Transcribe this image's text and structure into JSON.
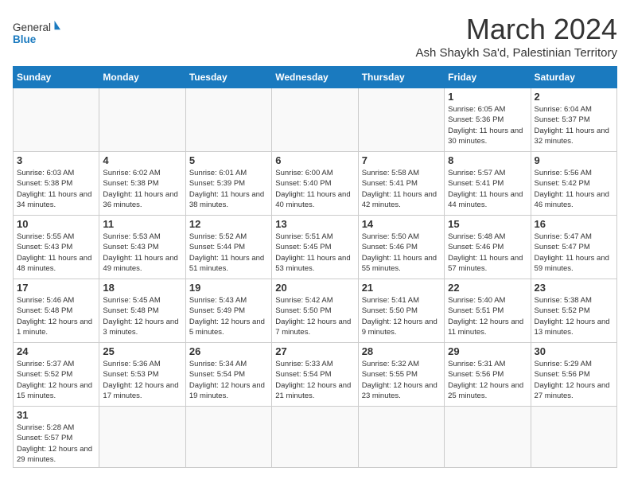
{
  "header": {
    "logo_general": "General",
    "logo_blue": "Blue",
    "month_title": "March 2024",
    "subtitle": "Ash Shaykh Sa'd, Palestinian Territory"
  },
  "weekdays": [
    "Sunday",
    "Monday",
    "Tuesday",
    "Wednesday",
    "Thursday",
    "Friday",
    "Saturday"
  ],
  "weeks": [
    [
      {
        "day": "",
        "info": ""
      },
      {
        "day": "",
        "info": ""
      },
      {
        "day": "",
        "info": ""
      },
      {
        "day": "",
        "info": ""
      },
      {
        "day": "",
        "info": ""
      },
      {
        "day": "1",
        "info": "Sunrise: 6:05 AM\nSunset: 5:36 PM\nDaylight: 11 hours\nand 30 minutes."
      },
      {
        "day": "2",
        "info": "Sunrise: 6:04 AM\nSunset: 5:37 PM\nDaylight: 11 hours\nand 32 minutes."
      }
    ],
    [
      {
        "day": "3",
        "info": "Sunrise: 6:03 AM\nSunset: 5:38 PM\nDaylight: 11 hours\nand 34 minutes."
      },
      {
        "day": "4",
        "info": "Sunrise: 6:02 AM\nSunset: 5:38 PM\nDaylight: 11 hours\nand 36 minutes."
      },
      {
        "day": "5",
        "info": "Sunrise: 6:01 AM\nSunset: 5:39 PM\nDaylight: 11 hours\nand 38 minutes."
      },
      {
        "day": "6",
        "info": "Sunrise: 6:00 AM\nSunset: 5:40 PM\nDaylight: 11 hours\nand 40 minutes."
      },
      {
        "day": "7",
        "info": "Sunrise: 5:58 AM\nSunset: 5:41 PM\nDaylight: 11 hours\nand 42 minutes."
      },
      {
        "day": "8",
        "info": "Sunrise: 5:57 AM\nSunset: 5:41 PM\nDaylight: 11 hours\nand 44 minutes."
      },
      {
        "day": "9",
        "info": "Sunrise: 5:56 AM\nSunset: 5:42 PM\nDaylight: 11 hours\nand 46 minutes."
      }
    ],
    [
      {
        "day": "10",
        "info": "Sunrise: 5:55 AM\nSunset: 5:43 PM\nDaylight: 11 hours\nand 48 minutes."
      },
      {
        "day": "11",
        "info": "Sunrise: 5:53 AM\nSunset: 5:43 PM\nDaylight: 11 hours\nand 49 minutes."
      },
      {
        "day": "12",
        "info": "Sunrise: 5:52 AM\nSunset: 5:44 PM\nDaylight: 11 hours\nand 51 minutes."
      },
      {
        "day": "13",
        "info": "Sunrise: 5:51 AM\nSunset: 5:45 PM\nDaylight: 11 hours\nand 53 minutes."
      },
      {
        "day": "14",
        "info": "Sunrise: 5:50 AM\nSunset: 5:46 PM\nDaylight: 11 hours\nand 55 minutes."
      },
      {
        "day": "15",
        "info": "Sunrise: 5:48 AM\nSunset: 5:46 PM\nDaylight: 11 hours\nand 57 minutes."
      },
      {
        "day": "16",
        "info": "Sunrise: 5:47 AM\nSunset: 5:47 PM\nDaylight: 11 hours\nand 59 minutes."
      }
    ],
    [
      {
        "day": "17",
        "info": "Sunrise: 5:46 AM\nSunset: 5:48 PM\nDaylight: 12 hours\nand 1 minute."
      },
      {
        "day": "18",
        "info": "Sunrise: 5:45 AM\nSunset: 5:48 PM\nDaylight: 12 hours\nand 3 minutes."
      },
      {
        "day": "19",
        "info": "Sunrise: 5:43 AM\nSunset: 5:49 PM\nDaylight: 12 hours\nand 5 minutes."
      },
      {
        "day": "20",
        "info": "Sunrise: 5:42 AM\nSunset: 5:50 PM\nDaylight: 12 hours\nand 7 minutes."
      },
      {
        "day": "21",
        "info": "Sunrise: 5:41 AM\nSunset: 5:50 PM\nDaylight: 12 hours\nand 9 minutes."
      },
      {
        "day": "22",
        "info": "Sunrise: 5:40 AM\nSunset: 5:51 PM\nDaylight: 12 hours\nand 11 minutes."
      },
      {
        "day": "23",
        "info": "Sunrise: 5:38 AM\nSunset: 5:52 PM\nDaylight: 12 hours\nand 13 minutes."
      }
    ],
    [
      {
        "day": "24",
        "info": "Sunrise: 5:37 AM\nSunset: 5:52 PM\nDaylight: 12 hours\nand 15 minutes."
      },
      {
        "day": "25",
        "info": "Sunrise: 5:36 AM\nSunset: 5:53 PM\nDaylight: 12 hours\nand 17 minutes."
      },
      {
        "day": "26",
        "info": "Sunrise: 5:34 AM\nSunset: 5:54 PM\nDaylight: 12 hours\nand 19 minutes."
      },
      {
        "day": "27",
        "info": "Sunrise: 5:33 AM\nSunset: 5:54 PM\nDaylight: 12 hours\nand 21 minutes."
      },
      {
        "day": "28",
        "info": "Sunrise: 5:32 AM\nSunset: 5:55 PM\nDaylight: 12 hours\nand 23 minutes."
      },
      {
        "day": "29",
        "info": "Sunrise: 5:31 AM\nSunset: 5:56 PM\nDaylight: 12 hours\nand 25 minutes."
      },
      {
        "day": "30",
        "info": "Sunrise: 5:29 AM\nSunset: 5:56 PM\nDaylight: 12 hours\nand 27 minutes."
      }
    ],
    [
      {
        "day": "31",
        "info": "Sunrise: 5:28 AM\nSunset: 5:57 PM\nDaylight: 12 hours\nand 29 minutes."
      },
      {
        "day": "",
        "info": ""
      },
      {
        "day": "",
        "info": ""
      },
      {
        "day": "",
        "info": ""
      },
      {
        "day": "",
        "info": ""
      },
      {
        "day": "",
        "info": ""
      },
      {
        "day": "",
        "info": ""
      }
    ]
  ]
}
